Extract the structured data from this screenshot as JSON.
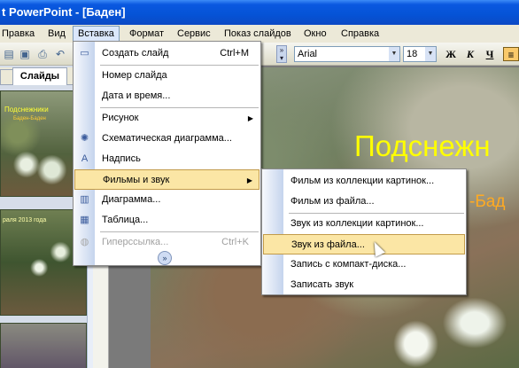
{
  "title_bar": {
    "title": "t PowerPoint - [Баден]"
  },
  "menubar": {
    "items": [
      "Правка",
      "Вид",
      "Вставка",
      "Формат",
      "Сервис",
      "Показ слайдов",
      "Окно",
      "Справка"
    ],
    "open_item": "Вставка"
  },
  "toolbar": {
    "font_name": "Arial",
    "font_size": "18",
    "bold": "Ж",
    "italic": "К",
    "underline": "Ч"
  },
  "left_panel": {
    "tab_slides": "Слайды",
    "thumb1_title": "Подснежники",
    "thumb1_sub": "Баден-Баден",
    "thumb2_text": "раля 2013 года"
  },
  "slide": {
    "title": "Подснежн",
    "subtitle": "-Бад"
  },
  "insert_menu": {
    "items": [
      {
        "label": "Создать слайд",
        "shortcut": "Ctrl+M",
        "icon": "new-slide-icon"
      },
      {
        "label": "Номер слайда",
        "shortcut": "",
        "icon": ""
      },
      {
        "label": "Дата и время...",
        "shortcut": "",
        "icon": ""
      },
      {
        "label": "Рисунок",
        "shortcut": "",
        "icon": "",
        "submenu": true
      },
      {
        "label": "Схематическая диаграмма...",
        "shortcut": "",
        "icon": "diagram-icon"
      },
      {
        "label": "Надпись",
        "shortcut": "",
        "icon": "textbox-icon"
      },
      {
        "label": "Фильмы и звук",
        "shortcut": "",
        "icon": "",
        "submenu": true,
        "highlighted": true
      },
      {
        "label": "Диаграмма...",
        "shortcut": "",
        "icon": "chart-icon"
      },
      {
        "label": "Таблица...",
        "shortcut": "",
        "icon": "table-icon"
      },
      {
        "label": "Гиперссылка...",
        "shortcut": "Ctrl+K",
        "icon": "hyperlink-icon",
        "disabled": true
      }
    ]
  },
  "movies_sound_menu": {
    "items": [
      {
        "label": "Фильм из коллекции картинок..."
      },
      {
        "label": "Фильм из файла..."
      },
      {
        "label": "Звук из коллекции картинок..."
      },
      {
        "label": "Звук из файла...",
        "highlighted": true
      },
      {
        "label": "Запись с компакт-диска..."
      },
      {
        "label": "Записать звук"
      }
    ]
  },
  "colors": {
    "highlight": "#fbe6a5",
    "title_bar": "#0553d6",
    "slide_title": "#ffff00"
  }
}
